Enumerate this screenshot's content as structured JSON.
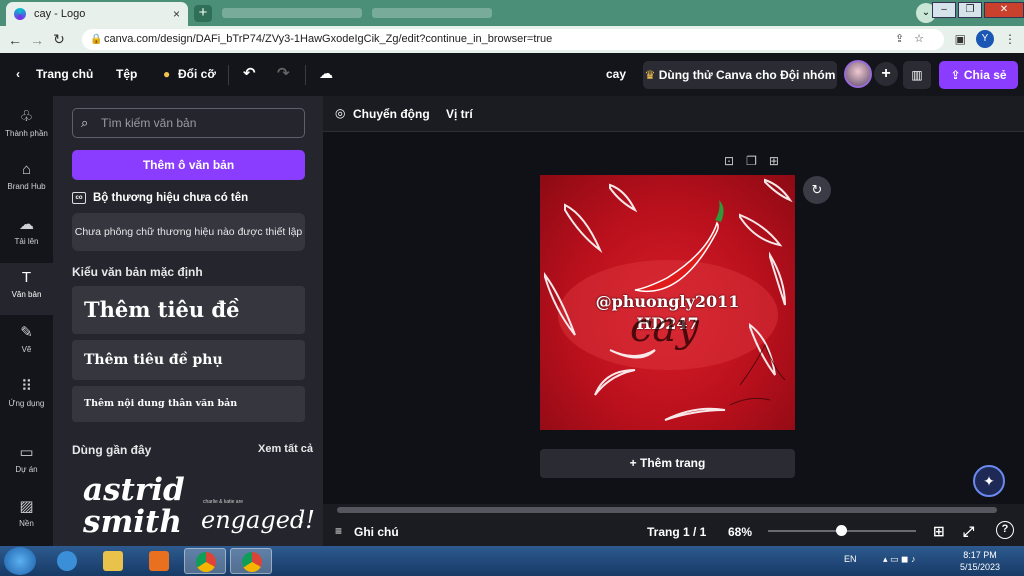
{
  "browser": {
    "tab_title": "cay - Logo",
    "tab_close": "×",
    "new_tab": "+",
    "url": "canva.com/design/DAFi_bTrP74/ZVy3-1HawGxodeIgCik_Zg/edit?continue_in_browser=true",
    "profile_initial": "Y"
  },
  "topbar": {
    "back_label": "Trang chủ",
    "file_label": "Tệp",
    "resize_label": "Đổi cỡ",
    "design_title": "cay",
    "trial_label": "Dùng thử Canva cho Đội nhóm",
    "share_label": "Chia sẻ"
  },
  "rail": [
    {
      "icon": "elements-icon",
      "label": "Thành phần"
    },
    {
      "icon": "brand-hub-icon",
      "label": "Brand Hub"
    },
    {
      "icon": "upload-icon",
      "label": "Tải lên"
    },
    {
      "icon": "text-icon",
      "label": "Văn bản"
    },
    {
      "icon": "draw-icon",
      "label": "Vẽ"
    },
    {
      "icon": "apps-icon",
      "label": "Ứng dụng"
    },
    {
      "icon": "folder-icon",
      "label": "Dự án"
    },
    {
      "icon": "background-icon",
      "label": "Nền"
    }
  ],
  "panel": {
    "search_placeholder": "Tìm kiếm văn bản",
    "add_textbox": "Thêm ô văn bản",
    "brand_kit_title": "Bộ thương hiệu chưa có tên",
    "brand_kit_empty": "Chưa phông chữ thương hiệu nào được thiết lập",
    "default_styles_title": "Kiểu văn bản mặc định",
    "heading": "Thêm tiêu đề",
    "subheading": "Thêm tiêu đề phụ",
    "body": "Thêm nội dung thân văn bản",
    "recent_title": "Dùng gần đây",
    "see_all": "Xem tất cả",
    "recent_1_line1": "astrid",
    "recent_1_line2": "smith",
    "recent_2_small": "charlie & katie are",
    "recent_2": "engaged!"
  },
  "context_bar": {
    "animate_label": "Chuyển động",
    "position_label": "Vị trí"
  },
  "design": {
    "text_line1": "@phuongly2011",
    "text_line2": "HD247",
    "script_text": "cay"
  },
  "editor": {
    "add_page": "+ Thêm trang"
  },
  "statusbar": {
    "notes_label": "Ghi chú",
    "page_indicator": "Trang 1 / 1",
    "zoom_percent": "68%",
    "zoom_level": 0.68
  },
  "taskbar": {
    "lang": "EN",
    "time": "8:17 PM",
    "date": "5/15/2023"
  },
  "colors": {
    "accent": "#8b3dff",
    "design_red": "#c4121e",
    "browser_tab_bg": "#4b8f79"
  }
}
